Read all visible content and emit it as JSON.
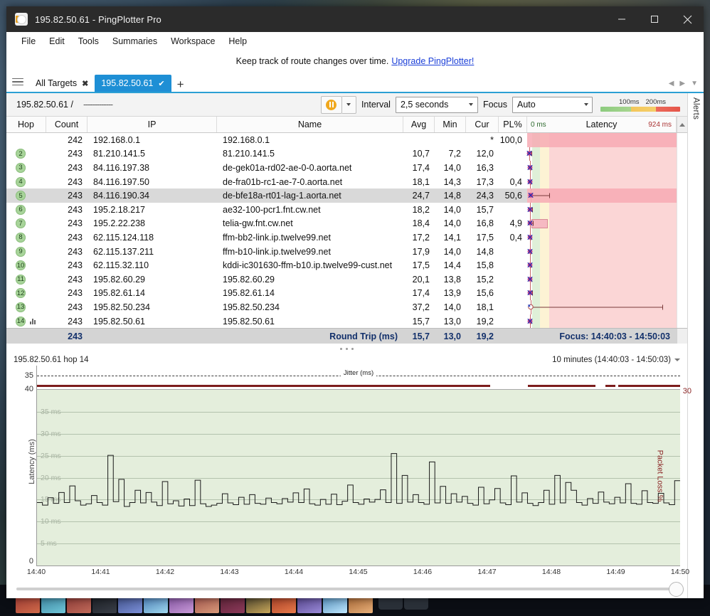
{
  "window": {
    "title": "195.82.50.61 - PingPlotter Pro",
    "icon": "pingplotter-icon",
    "minimize": "—",
    "maximize": "□",
    "close": "✕"
  },
  "menubar": [
    "File",
    "Edit",
    "Tools",
    "Summaries",
    "Workspace",
    "Help"
  ],
  "promo": {
    "text": "Keep track of route changes over time.",
    "link": "Upgrade PingPlotter!"
  },
  "tabs": {
    "all_targets": "All Targets",
    "all_targets_close": "✖",
    "active_tab": "195.82.50.61",
    "active_check": "✔",
    "add": "+",
    "nav_left": "◀",
    "nav_right": "▶",
    "nav_down": "▼"
  },
  "toolbar": {
    "target": "195.82.50.61 /",
    "target_dashes": "-------------",
    "pause_icon": "pause-icon",
    "split_arrow": "▼",
    "interval_label": "Interval",
    "interval_value": "2,5 seconds",
    "focus_label": "Focus",
    "focus_value": "Auto",
    "legend_low": "100ms",
    "legend_high": "200ms"
  },
  "alerts_rail": {
    "label": "Alerts"
  },
  "table": {
    "columns": [
      "Hop",
      "Count",
      "IP",
      "Name",
      "Avg",
      "Min",
      "Cur",
      "PL%"
    ],
    "latency_header": {
      "left": "0 ms",
      "center": "Latency",
      "right": "924 ms"
    },
    "rows": [
      {
        "hop": "",
        "count": "242",
        "ip": "192.168.0.1",
        "name": "192.168.0.1",
        "avg": "",
        "min": "",
        "cur": "*",
        "pl": "100,0",
        "selected": false,
        "band": true,
        "marker_x": 0.0,
        "whisker": 0.0,
        "minibars": false
      },
      {
        "hop": "2",
        "count": "243",
        "ip": "81.210.141.5",
        "name": "81.210.141.5",
        "avg": "10,7",
        "min": "7,2",
        "cur": "12,0",
        "pl": "",
        "selected": false,
        "band": false,
        "marker_x": 1.2,
        "whisker": 1.8,
        "minibars": false
      },
      {
        "hop": "3",
        "count": "243",
        "ip": "84.116.197.38",
        "name": "de-gek01a-rd02-ae-0-0.aorta.net",
        "avg": "17,4",
        "min": "14,0",
        "cur": "16,3",
        "pl": "",
        "selected": false,
        "band": false,
        "marker_x": 1.8,
        "whisker": 0.6,
        "minibars": false
      },
      {
        "hop": "4",
        "count": "243",
        "ip": "84.116.197.50",
        "name": "de-fra01b-rc1-ae-7-0.aorta.net",
        "avg": "18,1",
        "min": "14,3",
        "cur": "17,3",
        "pl": "0,4",
        "selected": false,
        "band": false,
        "marker_x": 1.9,
        "whisker": 0.6,
        "minibars": false
      },
      {
        "hop": "5",
        "count": "243",
        "ip": "84.116.190.34",
        "name": "de-bfe18a-rt01-lag-1.aorta.net",
        "avg": "24,7",
        "min": "14,8",
        "cur": "24,3",
        "pl": "50,6",
        "selected": true,
        "band": true,
        "marker_x": 2.6,
        "whisker": 12.0,
        "minibars": false
      },
      {
        "hop": "6",
        "count": "243",
        "ip": "195.2.18.217",
        "name": "ae32-100-pcr1.fnt.cw.net",
        "avg": "18,2",
        "min": "14,0",
        "cur": "15,7",
        "pl": "",
        "selected": false,
        "band": false,
        "marker_x": 2.0,
        "whisker": 1.2,
        "minibars": false
      },
      {
        "hop": "7",
        "count": "243",
        "ip": "195.2.22.238",
        "name": "telia-gw.fnt.cw.net",
        "avg": "18,4",
        "min": "14,0",
        "cur": "16,8",
        "pl": "4,9",
        "selected": false,
        "band": false,
        "marker_x": 2.0,
        "whisker": 2.0,
        "minibars": false,
        "pinkbox": [
          3.0,
          13.0
        ]
      },
      {
        "hop": "8",
        "count": "243",
        "ip": "62.115.124.118",
        "name": "ffm-bb2-link.ip.twelve99.net",
        "avg": "17,2",
        "min": "14,1",
        "cur": "17,5",
        "pl": "0,4",
        "selected": false,
        "band": false,
        "marker_x": 1.9,
        "whisker": 0.6,
        "minibars": false
      },
      {
        "hop": "9",
        "count": "243",
        "ip": "62.115.137.211",
        "name": "ffm-b10-link.ip.twelve99.net",
        "avg": "17,9",
        "min": "14,0",
        "cur": "14,8",
        "pl": "",
        "selected": false,
        "band": false,
        "marker_x": 1.9,
        "whisker": 0.5,
        "minibars": false
      },
      {
        "hop": "10",
        "count": "243",
        "ip": "62.115.32.110",
        "name": "kddi-ic301630-ffm-b10.ip.twelve99-cust.net",
        "avg": "17,5",
        "min": "14,4",
        "cur": "15,8",
        "pl": "",
        "selected": false,
        "band": false,
        "marker_x": 1.9,
        "whisker": 0.5,
        "minibars": false
      },
      {
        "hop": "11",
        "count": "243",
        "ip": "195.82.60.29",
        "name": "195.82.60.29",
        "avg": "20,1",
        "min": "13,8",
        "cur": "15,2",
        "pl": "",
        "selected": false,
        "band": false,
        "marker_x": 2.1,
        "whisker": 0.6,
        "minibars": false
      },
      {
        "hop": "12",
        "count": "243",
        "ip": "195.82.61.14",
        "name": "195.82.61.14",
        "avg": "17,4",
        "min": "13,9",
        "cur": "15,6",
        "pl": "",
        "selected": false,
        "band": false,
        "marker_x": 1.9,
        "whisker": 1.4,
        "minibars": false
      },
      {
        "hop": "13",
        "count": "243",
        "ip": "195.82.50.234",
        "name": "195.82.50.234",
        "avg": "37,2",
        "min": "14,0",
        "cur": "18,1",
        "pl": "",
        "selected": false,
        "band": false,
        "marker_x": 2.3,
        "whisker": 88.0,
        "minibars": false,
        "hollow": true
      },
      {
        "hop": "14",
        "count": "243",
        "ip": "195.82.50.61",
        "name": "195.82.50.61",
        "avg": "15,7",
        "min": "13,0",
        "cur": "19,2",
        "pl": "",
        "selected": false,
        "band": false,
        "marker_x": 1.8,
        "whisker": 0.5,
        "minibars": true
      }
    ],
    "summary": {
      "count": "243",
      "label": "Round Trip (ms)",
      "avg": "15,7",
      "min": "13,0",
      "cur": "19,2",
      "focus": "Focus: 14:40:03 - 14:50:03"
    }
  },
  "graph": {
    "header_left": "195.82.50.61 hop 14",
    "header_right": "10 minutes (14:40:03 - 14:50:03)",
    "jitter_label": "Jitter (ms)",
    "y_top_outer": "35",
    "y_second_outer": "40",
    "y_zero": "0",
    "right_top": "30",
    "right_title": "Packet Loss %",
    "y_title": "Latency (ms)"
  },
  "chart_data": {
    "type": "line",
    "title": "195.82.50.61 hop 14",
    "xlabel": "",
    "ylabel": "Latency (ms)",
    "y2label": "Packet Loss %",
    "ylim": [
      0,
      40
    ],
    "y2lim": [
      0,
      30
    ],
    "grid": true,
    "gridlabels": [
      "35 ms",
      "30 ms",
      "25 ms",
      "20 ms",
      "15 ms",
      "10 ms",
      "5 ms"
    ],
    "gridvalues": [
      35,
      30,
      25,
      20,
      15,
      10,
      5
    ],
    "xlim": [
      "14:40:03",
      "14:50:03"
    ],
    "xticks": [
      "14:40",
      "14:41",
      "14:42",
      "14:43",
      "14:44",
      "14:45",
      "14:46",
      "14:47",
      "14:48",
      "14:49",
      "14:50"
    ],
    "series": [
      {
        "name": "Latency (ms)",
        "color": "#1a1a1a",
        "step": true,
        "values": [
          14.2,
          13.6,
          15.3,
          14.0,
          16.5,
          14.2,
          18.0,
          14.6,
          13.6,
          13.9,
          15.8,
          14.2,
          13.6,
          25.0,
          14.4,
          19.5,
          13.3,
          14.2,
          17.0,
          14.1,
          16.5,
          14.3,
          13.5,
          19.0,
          13.9,
          14.6,
          13.4,
          15.0,
          13.5,
          19.3,
          13.9,
          13.3,
          13.6,
          14.0,
          16.2,
          14.1,
          13.7,
          15.4,
          13.8,
          16.0,
          14.0,
          13.8,
          15.2,
          14.2,
          13.9,
          15.1,
          14.3,
          16.4,
          14.2,
          17.3,
          13.9,
          13.6,
          14.9,
          13.8,
          16.1,
          13.7,
          14.5,
          18.2,
          14.2,
          13.8,
          15.0,
          14.3,
          14.9,
          17.1,
          14.2,
          25.4,
          14.0,
          20.4,
          14.3,
          16.0,
          14.2,
          13.8,
          23.5,
          14.1,
          17.9,
          14.0,
          16.2,
          14.3,
          15.6,
          14.0,
          13.6,
          17.7,
          13.9,
          14.8,
          17.4,
          14.1,
          13.7,
          20.3,
          14.3,
          16.4,
          14.0,
          13.5,
          14.2,
          17.0,
          13.8,
          20.4,
          14.1,
          18.8,
          17.0,
          14.2,
          13.6,
          15.1,
          14.0,
          16.6,
          14.3,
          13.9,
          15.4,
          14.1,
          18.5,
          14.0,
          13.8,
          16.9,
          14.2,
          14.0,
          16.3,
          14.1,
          13.7,
          19.2
        ]
      },
      {
        "name": "Packet Loss %",
        "color": "#7c1d1d",
        "values": [
          0,
          0,
          0,
          0,
          0,
          0,
          0,
          0,
          0,
          0,
          0,
          0,
          0,
          0,
          0,
          0,
          0,
          0,
          0,
          0,
          0,
          0,
          0,
          0,
          0,
          0,
          0,
          0,
          0,
          0
        ]
      }
    ]
  },
  "hscroll": {
    "thumb": "scroll-thumb"
  }
}
